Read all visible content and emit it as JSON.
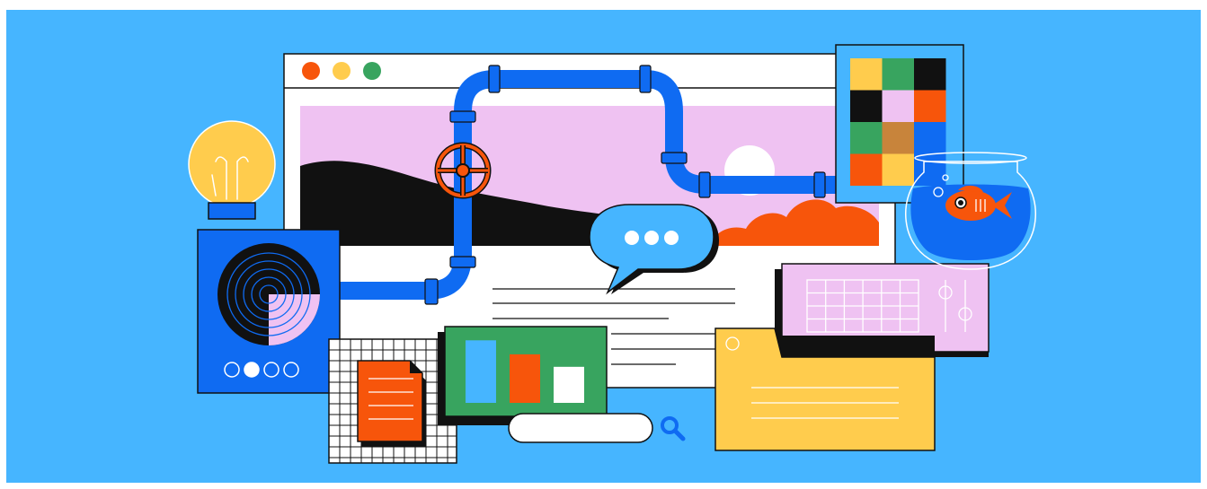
{
  "scene": {
    "kind": "illustration",
    "colors": {
      "background": "#46b5ff",
      "pipe": "#0f6bf2",
      "outline": "#111111",
      "pink": "#efc2f2",
      "orange": "#f7550b",
      "yellow": "#ffcc4d",
      "green": "#38a45f",
      "white": "#ffffff"
    },
    "icons": [
      "browser-window",
      "traffic-light-dots",
      "pipe",
      "valve-wheel",
      "light-bulb",
      "speaker-device",
      "chat-bubble",
      "color-grid",
      "fish-bowl",
      "goldfish",
      "calendar-card",
      "slider-controls",
      "folder-note",
      "bar-chart-card",
      "document-icon",
      "grid-paper",
      "search-bar",
      "search-icon"
    ],
    "chat_bubble_dots": 3,
    "device_page_dots": 4,
    "device_active_dot": 1,
    "color_grid": [
      [
        "#ffcc4d",
        "#38a45f",
        "#111111"
      ],
      [
        "#111111",
        "#efc2f2",
        "#f7550b"
      ],
      [
        "#38a45f",
        "#c8843b",
        "#0f6bf2"
      ],
      [
        "#f7550b",
        "#ffcc4d",
        "#0f6bf2"
      ]
    ],
    "bar_chart_values": [
      0.85,
      0.66,
      0.49
    ]
  }
}
